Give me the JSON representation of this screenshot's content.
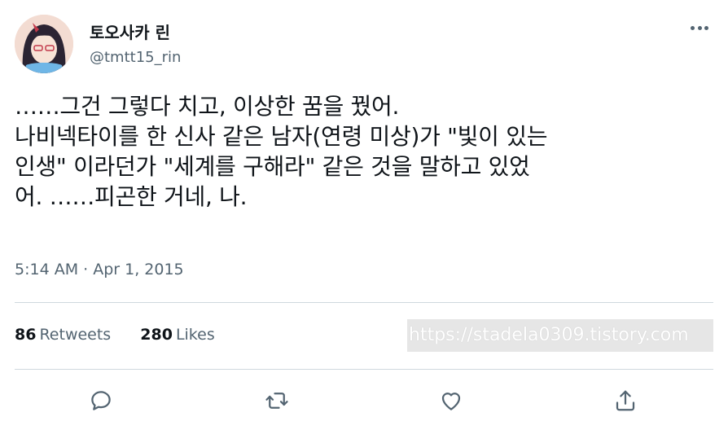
{
  "user": {
    "display_name": "토오사카 린",
    "handle": "@tmtt15_rin"
  },
  "tweet": {
    "text": "……그건 그렇다 치고, 이상한 꿈을 꿨어.\n나비넥타이를 한 신사 같은 남자(연령 미상)가 \"빛이 있는\n인생\" 이라던가 \"세계를 구해라\" 같은 것을 말하고 있었\n어. ……피곤한 거네, 나.",
    "timestamp": "5:14 AM · Apr 1, 2015"
  },
  "stats": {
    "retweets_count": "86",
    "retweets_label": "Retweets",
    "likes_count": "280",
    "likes_label": "Likes"
  },
  "watermark": "https://stadela0309.tistory.com",
  "icons": {
    "more": "more-horizontal-icon",
    "reply": "reply-icon",
    "retweet": "retweet-icon",
    "like": "heart-icon",
    "share": "share-icon"
  },
  "colors": {
    "text_primary": "#0f1419",
    "text_secondary": "#536471",
    "divider": "#cfd9de"
  }
}
